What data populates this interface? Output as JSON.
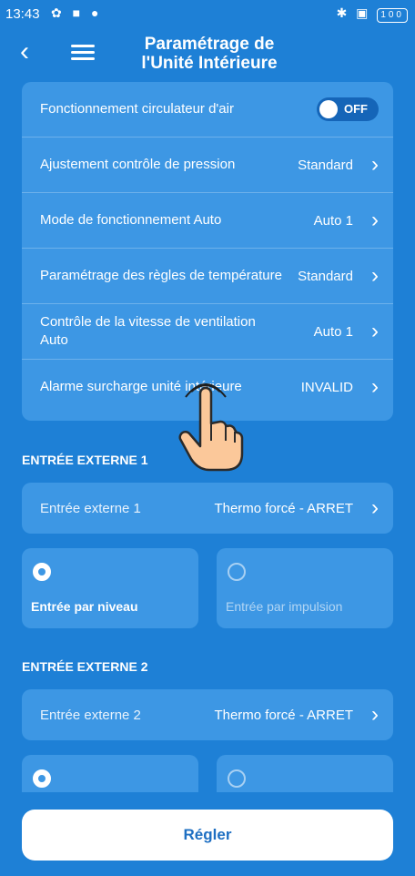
{
  "status_bar": {
    "time": "13:43",
    "battery": "100"
  },
  "header": {
    "title_line1": "Paramétrage de",
    "title_line2": "l'Unité Intérieure"
  },
  "settings": {
    "rows": [
      {
        "label": "Fonctionnement circulateur d'air",
        "value": "OFF"
      },
      {
        "label": "Ajustement contrôle de pression",
        "value": "Standard"
      },
      {
        "label": "Mode de fonctionnement Auto",
        "value": "Auto 1"
      },
      {
        "label": "Paramétrage des règles de température",
        "value": "Standard"
      },
      {
        "label": "Contrôle de la vitesse de ventilation Auto",
        "value": "Auto 1"
      },
      {
        "label": "Alarme surcharge unité intérieure",
        "value": "INVALID"
      }
    ]
  },
  "external_1": {
    "section_title": "ENTRÉE EXTERNE 1",
    "label": "Entrée externe 1",
    "value": "Thermo forcé - ARRET",
    "options": [
      {
        "label": "Entrée par niveau",
        "selected": true
      },
      {
        "label": "Entrée par impulsion",
        "selected": false
      }
    ]
  },
  "external_2": {
    "section_title": "ENTRÉE EXTERNE 2",
    "label": "Entrée externe 2",
    "value": "Thermo forcé - ARRET"
  },
  "footer": {
    "button_label": "Régler"
  },
  "colors": {
    "background": "#1e80d6",
    "card": "#3d97e4",
    "button_text": "#1e6fc2"
  }
}
